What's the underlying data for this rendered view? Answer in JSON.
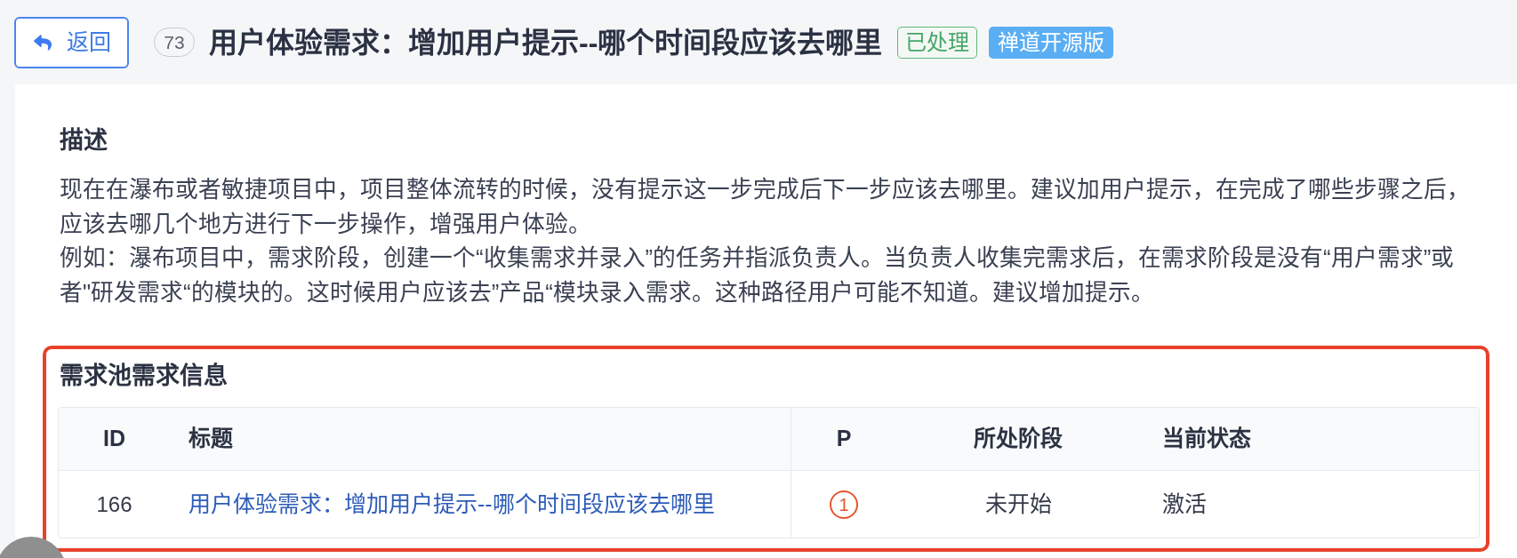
{
  "header": {
    "back_button": "返回",
    "id_badge": "73",
    "title": "用户体验需求：增加用户提示--哪个时间段应该去哪里",
    "tags": [
      {
        "label": "已处理",
        "kind": "status"
      },
      {
        "label": "禅道开源版",
        "kind": "edition"
      }
    ]
  },
  "description": {
    "heading": "描述",
    "paragraphs": [
      "现在在瀑布或者敏捷项目中，项目整体流转的时候，没有提示这一步完成后下一步应该去哪里。建议加用户提示，在完成了哪些步骤之后，应该去哪几个地方进行下一步操作，增强用户体验。",
      "例如：瀑布项目中，需求阶段，创建一个“收集需求并录入”的任务并指派负责人。当负责人收集完需求后，在需求阶段是没有“用户需求”或者\"研发需求“的模块的。这时候用户应该去”产品“模块录入需求。这种路径用户可能不知道。建议增加提示。"
    ]
  },
  "requirement_pool": {
    "highlighted": true,
    "heading": "需求池需求信息",
    "table": {
      "columns": [
        "ID",
        "标题",
        "P",
        "所处阶段",
        "当前状态"
      ],
      "rows": [
        {
          "id": "166",
          "title": "用户体验需求：增加用户提示--哪个时间段应该去哪里",
          "priority": "1",
          "stage": "未开始",
          "status": "激活"
        }
      ]
    }
  }
}
